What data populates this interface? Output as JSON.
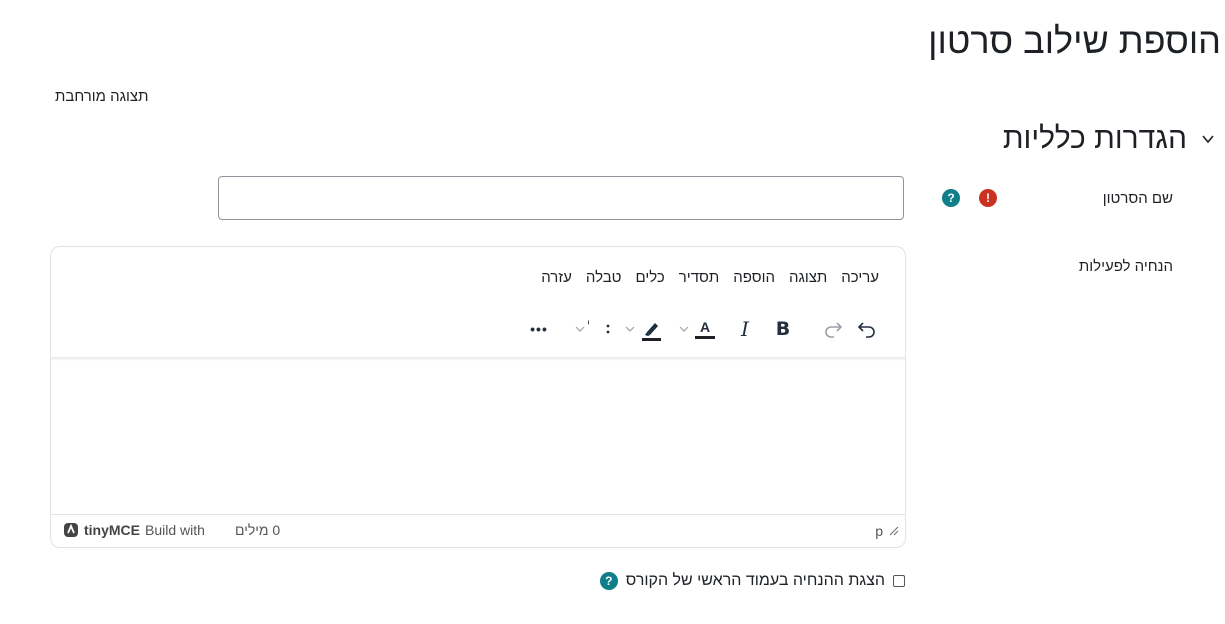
{
  "page_title": "הוספת שילוב סרטון",
  "expand_all_label": "תצוגה מורחבת",
  "section": {
    "title": "הגדרות כלליות"
  },
  "name_field": {
    "label": "שם הסרטון",
    "value": "",
    "required_icon": "exclamation-icon",
    "help_icon": "question-icon"
  },
  "intro_field": {
    "label": "הנחיה לפעילות"
  },
  "editor": {
    "menu": [
      "עריכה",
      "תצוגה",
      "הוספה",
      "תסדיר",
      "כלים",
      "טבלה",
      "עזרה"
    ],
    "toolbar": {
      "bold": "B",
      "italic": "I",
      "text_color": "A",
      "more": "•••"
    },
    "status": {
      "path": "p",
      "word_count": "0 מילים",
      "build_with": "Build with",
      "brand": "tinyMCE"
    }
  },
  "show_description": {
    "label": "הצגת ההנחיה בעמוד הראשי של הקורס",
    "checked": false
  },
  "colors": {
    "required": "#ca3120",
    "help": "#0d7e8a"
  }
}
